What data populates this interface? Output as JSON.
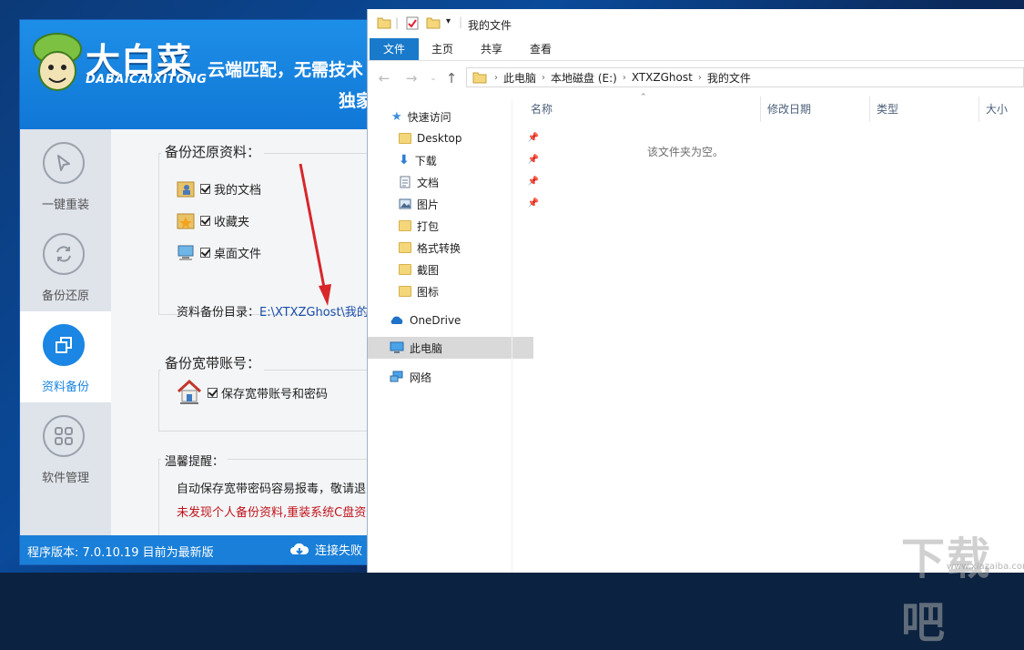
{
  "app": {
    "logo_cn": "大白菜",
    "logo_en": "DABAICAIXITONG",
    "slogan_line1": "云端匹配，无需技术",
    "slogan_line2": "独家",
    "sidebar": [
      {
        "label": "一键重装",
        "icon": "cursor-arrow-icon",
        "active": false
      },
      {
        "label": "备份还原",
        "icon": "refresh-icon",
        "active": false
      },
      {
        "label": "资料备份",
        "icon": "copy-icon",
        "active": true
      },
      {
        "label": "软件管理",
        "icon": "grid-icon",
        "active": false
      }
    ],
    "backup_group": {
      "title": "备份还原资料：",
      "items": [
        {
          "label": "我的文档",
          "checked": true,
          "icon": "user-folder-icon"
        },
        {
          "label": "收藏夹",
          "checked": true,
          "icon": "favorites-folder-icon"
        },
        {
          "label": "桌面文件",
          "checked": true,
          "icon": "desktop-icon"
        }
      ],
      "dir_label": "资料备份目录：",
      "dir_value": "E:\\XTXZGhost\\我的文"
    },
    "broadband_group": {
      "title": "备份宽带账号：",
      "item_label": "保存宽带账号和密码",
      "checked": true
    },
    "tips": {
      "title": "温馨提醒：",
      "line1": "自动保存宽带密码容易报毒，敬请退",
      "line2": "未发现个人备份资料,重装系统C盘资"
    },
    "footer": {
      "version": "程序版本: 7.0.10.19 目前为最新版",
      "status": "连接失败"
    }
  },
  "explorer": {
    "title": "我的文件",
    "ribbon_tabs": [
      "文件",
      "主页",
      "共享",
      "查看"
    ],
    "breadcrumb": [
      "此电脑",
      "本地磁盘 (E:)",
      "XTXZGhost",
      "我的文件"
    ],
    "nav_pane": [
      {
        "label": "快速访问",
        "icon": "star-icon",
        "pinned": false,
        "indent": 0
      },
      {
        "label": "Desktop",
        "icon": "folder-icon",
        "pinned": true,
        "indent": 1
      },
      {
        "label": "下载",
        "icon": "download-icon",
        "pinned": true,
        "indent": 1
      },
      {
        "label": "文档",
        "icon": "document-icon",
        "pinned": true,
        "indent": 1
      },
      {
        "label": "图片",
        "icon": "picture-icon",
        "pinned": true,
        "indent": 1
      },
      {
        "label": "打包",
        "icon": "folder-icon",
        "pinned": false,
        "indent": 1
      },
      {
        "label": "格式转换",
        "icon": "folder-icon",
        "pinned": false,
        "indent": 1
      },
      {
        "label": "截图",
        "icon": "folder-icon",
        "pinned": false,
        "indent": 1
      },
      {
        "label": "图标",
        "icon": "folder-icon",
        "pinned": false,
        "indent": 1
      },
      {
        "label": "OneDrive",
        "icon": "cloud-icon",
        "pinned": false,
        "indent": 0
      },
      {
        "label": "此电脑",
        "icon": "computer-icon",
        "pinned": false,
        "indent": 0,
        "selected": true
      },
      {
        "label": "网络",
        "icon": "network-icon",
        "pinned": false,
        "indent": 0
      }
    ],
    "columns": [
      "名称",
      "修改日期",
      "类型",
      "大小"
    ],
    "empty_message": "该文件夹为空。"
  },
  "watermark": {
    "text": "下载吧",
    "sub": "www.xiazaiba.com"
  },
  "colors": {
    "accent": "#1b86e3",
    "header": "#1177d6",
    "warn": "#c0141b",
    "ribbon_file": "#1979ca",
    "arrow": "#d8262a"
  }
}
